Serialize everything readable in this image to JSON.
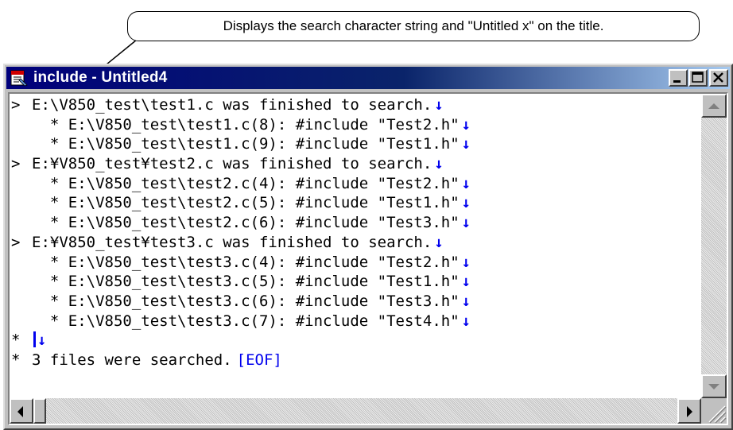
{
  "callout": {
    "text": "Displays the search character string and \"Untitled x\" on the title."
  },
  "window": {
    "title": "include - Untitled4",
    "controls": {
      "minimize_icon": "minimize-icon",
      "maximize_icon": "maximize-icon",
      "close_icon": "close-icon"
    }
  },
  "lines": [
    {
      "kind": "file",
      "gutter": ">",
      "text": "E:\\V850_test\\test1.c was finished to search.",
      "mark": "↓"
    },
    {
      "kind": "hit",
      "gutter": "",
      "text": "  * E:\\V850_test\\test1.c(8): #include \"Test2.h\"",
      "mark": "↓"
    },
    {
      "kind": "hit",
      "gutter": "",
      "text": "  * E:\\V850_test\\test1.c(9): #include \"Test1.h\"",
      "mark": "↓"
    },
    {
      "kind": "file",
      "gutter": ">",
      "text": "E:¥V850_test¥test2.c was finished to search.",
      "mark": "↓"
    },
    {
      "kind": "hit",
      "gutter": "",
      "text": "  * E:\\V850_test\\test2.c(4): #include \"Test2.h\"",
      "mark": "↓"
    },
    {
      "kind": "hit",
      "gutter": "",
      "text": "  * E:\\V850_test\\test2.c(5): #include \"Test1.h\"",
      "mark": "↓"
    },
    {
      "kind": "hit",
      "gutter": "",
      "text": "  * E:\\V850_test\\test2.c(6): #include \"Test3.h\"",
      "mark": "↓"
    },
    {
      "kind": "file",
      "gutter": ">",
      "text": "E:¥V850_test¥test3.c was finished to search.",
      "mark": "↓"
    },
    {
      "kind": "hit",
      "gutter": "",
      "text": "  * E:\\V850_test\\test3.c(4): #include \"Test2.h\"",
      "mark": "↓"
    },
    {
      "kind": "hit",
      "gutter": "",
      "text": "  * E:\\V850_test\\test3.c(5): #include \"Test1.h\"",
      "mark": "↓"
    },
    {
      "kind": "hit",
      "gutter": "",
      "text": "  * E:\\V850_test\\test3.c(6): #include \"Test3.h\"",
      "mark": "↓"
    },
    {
      "kind": "hit",
      "gutter": "",
      "text": "  * E:\\V850_test\\test3.c(7): #include \"Test4.h\"",
      "mark": "↓"
    }
  ],
  "cursor_line": {
    "gutter": "*",
    "mark": "↓"
  },
  "summary_line": {
    "gutter": "*",
    "text": "3 files were searched.",
    "eof": "[EOF]"
  },
  "colors": {
    "title_bar_start": "#00007b",
    "title_bar_end": "#a6caf0",
    "mark_color": "#0000ee",
    "window_face": "#c0c0c0"
  }
}
